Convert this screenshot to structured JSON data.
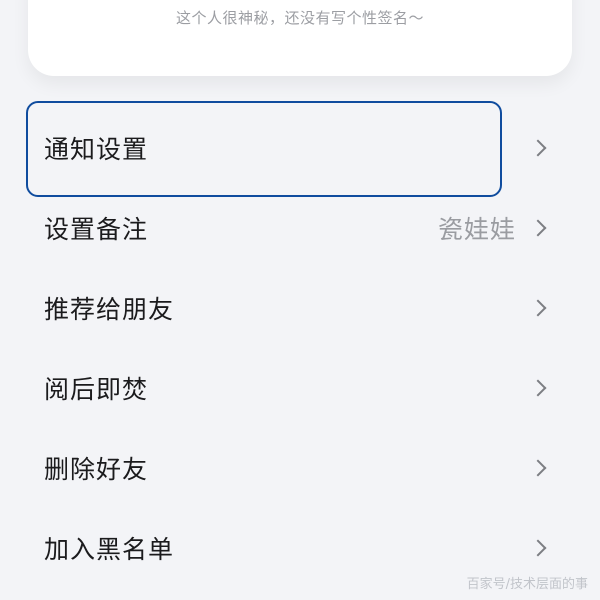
{
  "profile": {
    "signature": "这个人很神秘，还没有写个性签名～"
  },
  "menu": {
    "items": [
      {
        "label": "通知设置",
        "value": ""
      },
      {
        "label": "设置备注",
        "value": "瓷娃娃"
      },
      {
        "label": "推荐给朋友",
        "value": ""
      },
      {
        "label": "阅后即焚",
        "value": ""
      },
      {
        "label": "删除好友",
        "value": ""
      },
      {
        "label": "加入黑名单",
        "value": ""
      }
    ]
  },
  "watermark": {
    "text": "百家号/技术层面的事"
  },
  "colors": {
    "background": "#f3f4f7",
    "card": "#ffffff",
    "focus_border": "#0f4c9e",
    "text_primary": "#1b1b1d",
    "text_secondary": "#9a9ca1"
  },
  "icons": {
    "row_chevron": "chevron-right-icon"
  }
}
